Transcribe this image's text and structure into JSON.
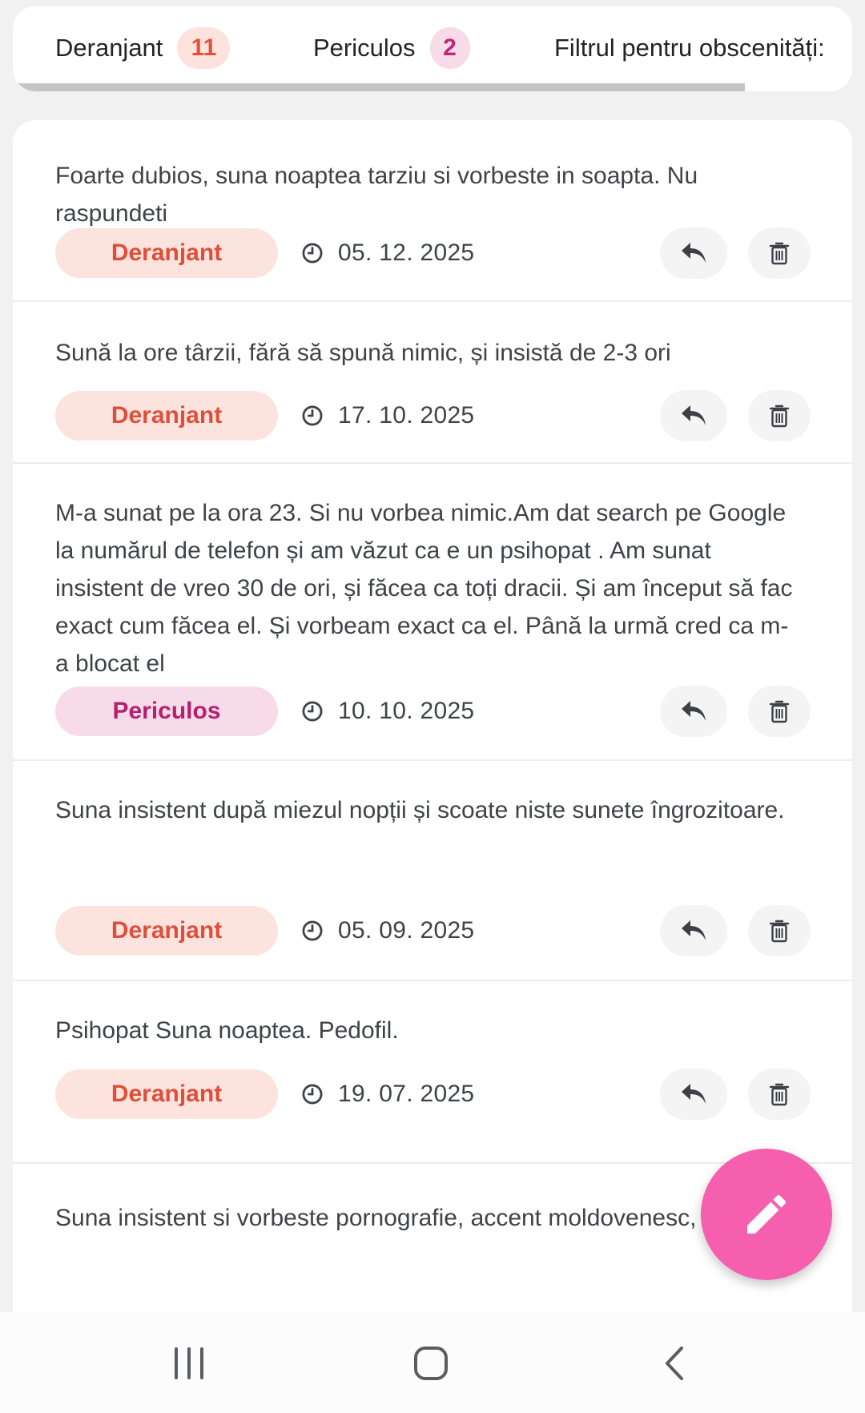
{
  "tabs": [
    {
      "label": "Deranjant",
      "count": "11"
    },
    {
      "label": "Periculos",
      "count": "2"
    },
    {
      "label": "Filtrul pentru obscenități:"
    }
  ],
  "reports": [
    {
      "text": "Foarte dubios, suna noaptea tarziu si vorbeste in soapta. Nu raspundeti",
      "category": "Deranjant",
      "date": "05. 12. 2025"
    },
    {
      "text": "Sună la ore târzii, fără să spună nimic, și insistă de 2-3 ori",
      "category": "Deranjant",
      "date": "17. 10. 2025"
    },
    {
      "text": "M-a sunat pe la ora 23. Si nu vorbea nimic.Am dat search pe Google la numărul de telefon și am văzut ca e un psihopat . Am sunat insistent de vreo 30 de ori, și făcea ca toți dracii. Și am început să fac exact cum făcea el. Și vorbeam exact ca el. Până la urmă cred ca m-a blocat el",
      "category": "Periculos",
      "date": "10. 10. 2025"
    },
    {
      "text": "Suna insistent după miezul nopții și scoate niste sunete îngrozitoare.",
      "category": "Deranjant",
      "date": "05. 09. 2025"
    },
    {
      "text": "Psihopat Suna noaptea. Pedofil.",
      "category": "Deranjant",
      "date": "19. 07. 2025"
    },
    {
      "text": "Suna insistent si vorbeste pornografie, accent moldovenesc, un"
    }
  ],
  "colors": {
    "disturbing": "#dd4f3a",
    "dangerous": "#b5206f",
    "fab": "#f65fae"
  },
  "icons": {
    "clock": "clock-icon",
    "reply": "reply-icon",
    "delete": "trash-icon",
    "fab": "pencil-icon"
  }
}
